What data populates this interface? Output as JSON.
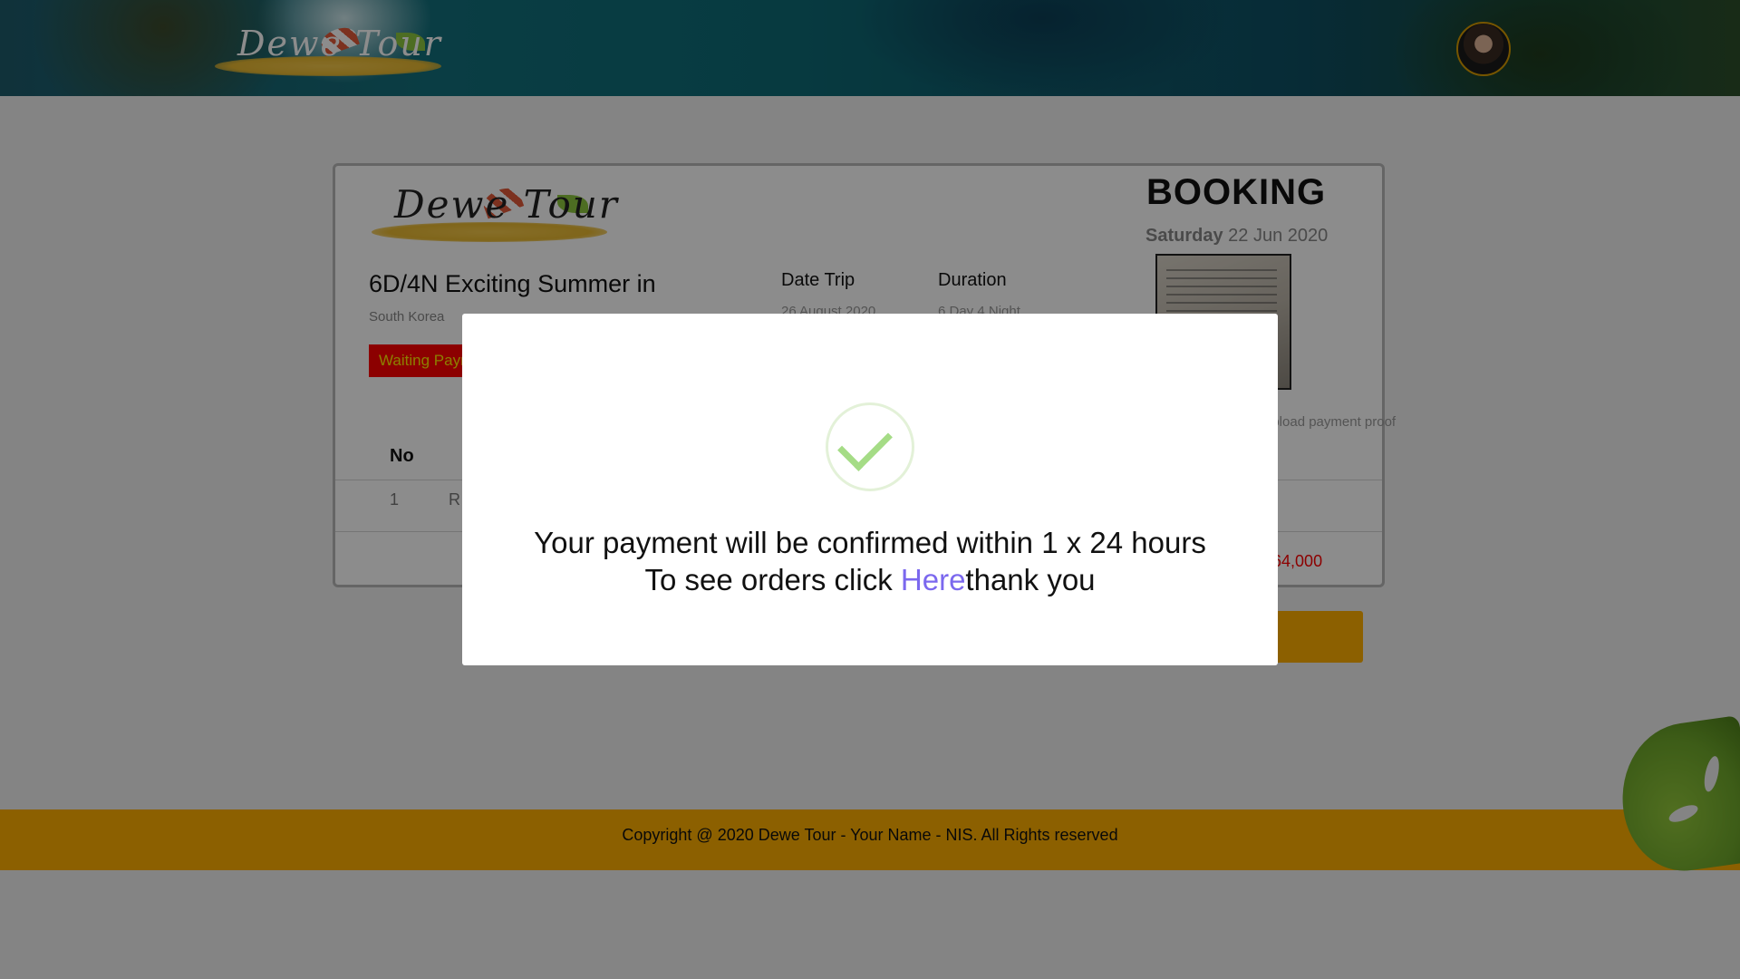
{
  "header": {
    "logo_text": "Dewe Tour",
    "avatar_icon": "user-avatar-icon"
  },
  "booking": {
    "logo_text": "Dewe Tour",
    "title": "BOOKING",
    "date_day": "Saturday",
    "date_rest": " 22 Jun 2020",
    "trip_title": "6D/4N Exciting Summer in",
    "country": "South Korea",
    "status": "Waiting Payment",
    "date_trip_label": "Date Trip",
    "date_trip_value": "26 August 2020",
    "duration_label": "Duration",
    "duration_value": "6 Day 4 Night",
    "proof_label": "upload payment proof",
    "table_no_label": "No",
    "row_no": "1",
    "row_name": "R",
    "total_value": "0,864,000",
    "colors": {
      "status_bg": "#ff0000",
      "status_text": "#ffe600",
      "accent": "#ffaf00"
    }
  },
  "footer": {
    "copyright": "Copyright @ 2020 Dewe Tour - Your Name - NIS. All Rights reserved"
  },
  "modal": {
    "icon": "success-check-icon",
    "message_before": "Your payment will be confirmed within 1 x 24 hours To see orders click ",
    "link_text": "Here",
    "message_after": "thank you",
    "colors": {
      "check": "#a5dc86",
      "link": "#7b68ee"
    }
  }
}
